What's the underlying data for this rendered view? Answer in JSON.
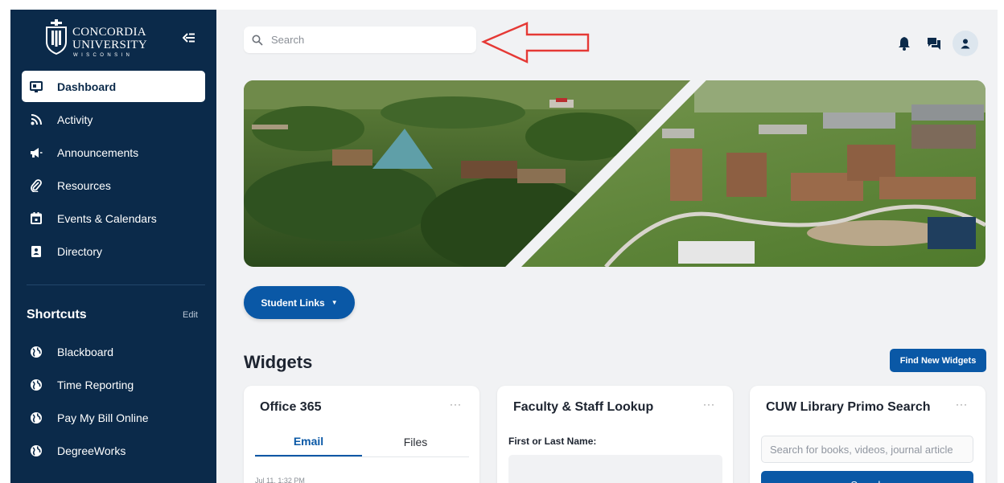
{
  "sidebar": {
    "logo": {
      "line1": "CONCORDIA",
      "line2": "UNIVERSITY",
      "line3": "WISCONSIN"
    },
    "nav": [
      {
        "label": "Dashboard",
        "icon": "dashboard-icon",
        "active": true
      },
      {
        "label": "Activity",
        "icon": "rss-icon"
      },
      {
        "label": "Announcements",
        "icon": "megaphone-icon"
      },
      {
        "label": "Resources",
        "icon": "paperclip-icon"
      },
      {
        "label": "Events & Calendars",
        "icon": "calendar-icon"
      },
      {
        "label": "Directory",
        "icon": "contact-card-icon"
      }
    ],
    "shortcuts_title": "Shortcuts",
    "edit_label": "Edit",
    "shortcuts": [
      {
        "label": "Blackboard",
        "icon": "globe-icon"
      },
      {
        "label": "Time Reporting",
        "icon": "globe-icon"
      },
      {
        "label": "Pay My Bill Online",
        "icon": "globe-icon"
      },
      {
        "label": "DegreeWorks",
        "icon": "globe-icon"
      }
    ]
  },
  "header": {
    "search_placeholder": "Search",
    "icons": [
      "bell-icon",
      "chat-icon",
      "user-avatar-icon"
    ]
  },
  "main": {
    "student_links_label": "Student Links",
    "widgets_title": "Widgets",
    "find_widgets_label": "Find New Widgets",
    "cards": {
      "office": {
        "title": "Office 365",
        "more": "···",
        "tabs": [
          "Email",
          "Files"
        ],
        "active_tab": "Email",
        "email_date": "Jul 11, 1:32 PM"
      },
      "lookup": {
        "title": "Faculty & Staff Lookup",
        "more": "···",
        "field_label": "First or Last Name:"
      },
      "primo": {
        "title": "CUW Library Primo Search",
        "more": "···",
        "placeholder": "Search for books, videos, journal article",
        "button_label": "Search"
      }
    }
  },
  "colors": {
    "sidebar": "#0b2a4a",
    "accent": "#0a58a6",
    "annotation_arrow": "#e53935"
  }
}
